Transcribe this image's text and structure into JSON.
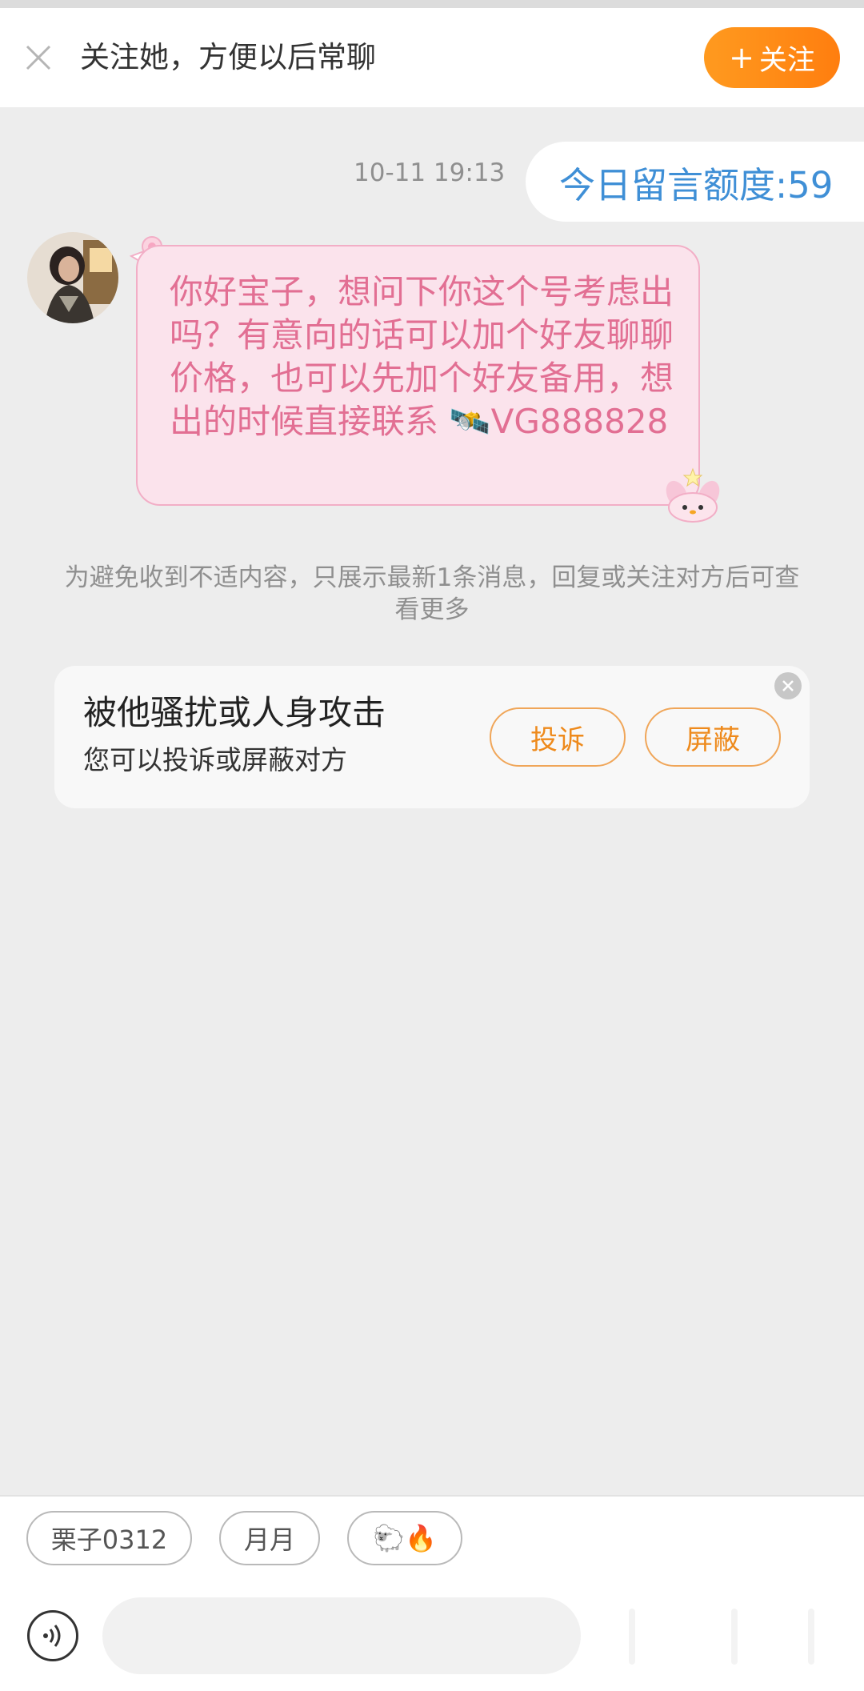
{
  "header": {
    "title": "关注她，方便以后常聊",
    "follow_label": "关注"
  },
  "chat": {
    "timestamp": "10-11 19:13",
    "quota_label": "今日留言额度:59",
    "message_text_a": "你好宝子，想问下你这个号考虑出吗？有意向的话可以加个好友聊聊价格，也可以先加个好友备用，想出的时候直接联系 ",
    "message_emoji": "🛰️",
    "message_text_b": "VG888828",
    "notice": "为避免收到不适内容，只展示最新1条消息，回复或关注对方后可查看更多"
  },
  "report_card": {
    "title": "被他骚扰或人身攻击",
    "subtitle": "您可以投诉或屏蔽对方",
    "complain_label": "投诉",
    "block_label": "屏蔽"
  },
  "quick_replies": [
    "栗子0312",
    "月月",
    "🐑🔥"
  ],
  "input": {
    "placeholder": ""
  },
  "colors": {
    "accent_orange": "#ff8c1a",
    "bubble_pink": "#fbe3ec",
    "bubble_text": "#e26f93",
    "quota_blue": "#3f8fd6"
  },
  "icons": [
    "close-icon",
    "plus-icon",
    "voice-icon",
    "card-close-icon"
  ]
}
